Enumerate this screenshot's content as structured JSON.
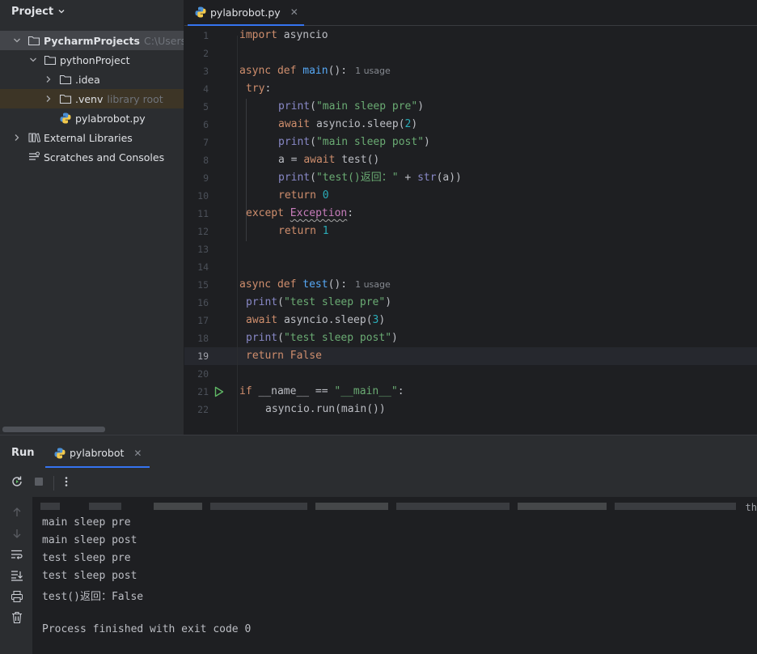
{
  "project_panel": {
    "title": "Project",
    "tree": [
      {
        "name": "PycharmProjects",
        "path": "C:\\Users\\m"
      },
      {
        "name": "pythonProject"
      },
      {
        "name": ".idea"
      },
      {
        "name": ".venv",
        "note": "library root"
      },
      {
        "name": "pylabrobot.py"
      },
      {
        "name": "External Libraries"
      },
      {
        "name": "Scratches and Consoles"
      }
    ]
  },
  "editor": {
    "tab_label": "pylabrobot.py",
    "current_line": 19,
    "line_numbers": [
      "1",
      "2",
      "3",
      "4",
      "5",
      "6",
      "7",
      "8",
      "9",
      "10",
      "11",
      "12",
      "13",
      "14",
      "15",
      "16",
      "17",
      "18",
      "19",
      "20",
      "21",
      "22"
    ],
    "code": {
      "l1_kw": "import",
      "l1_rest": " asyncio",
      "l3_kw1": "async",
      "l3_kw2": "def",
      "l3_fn": "main",
      "l3_rest": "():",
      "l3_hint": "1 usage",
      "l4_kw": "try",
      "l4_rest": ":",
      "l5_bi": "print",
      "l5_p1": "(",
      "l5_str": "\"main sleep pre\"",
      "l5_p2": ")",
      "l6_kw": "await",
      "l6_rest": " asyncio.sleep(",
      "l6_num": "2",
      "l6_p2": ")",
      "l7_bi": "print",
      "l7_p1": "(",
      "l7_str": "\"main sleep post\"",
      "l7_p2": ")",
      "l8_a": "a = ",
      "l8_kw": "await",
      "l8_rest": " test()",
      "l9_bi": "print",
      "l9_p1": "(",
      "l9_str": "\"test()返回：\"",
      "l9_mid": " + ",
      "l9_bi2": "str",
      "l9_p2": "(a))",
      "l10_kw": "return",
      "l10_num": "0",
      "l11_kw": "except",
      "l11_cls": "Exception",
      "l11_rest": ":",
      "l12_kw": "return",
      "l12_num": "1",
      "l15_kw1": "async",
      "l15_kw2": "def",
      "l15_fn": "test",
      "l15_rest": "():",
      "l15_hint": "1 usage",
      "l16_bi": "print",
      "l16_p1": "(",
      "l16_str": "\"test sleep pre\"",
      "l16_p2": ")",
      "l17_kw": "await",
      "l17_rest": " asyncio.sleep(",
      "l17_num": "3",
      "l17_p2": ")",
      "l18_bi": "print",
      "l18_p1": "(",
      "l18_str": "\"test sleep post\"",
      "l18_p2": ")",
      "l19_kw": "return",
      "l19_kw2": "False",
      "l21_kw": "if",
      "l21_mid": " __name__ == ",
      "l21_str": "\"__main__\"",
      "l21_rest": ":",
      "l22_rest": "asyncio.run(main())"
    }
  },
  "run_panel": {
    "title": "Run",
    "tab_label": "pylabrobot",
    "blurred_tail": "th",
    "output": [
      "main sleep pre",
      "main sleep post",
      "test sleep pre",
      "test sleep post",
      "test()返回：False",
      "",
      "Process finished with exit code 0"
    ]
  },
  "colors": {
    "keyword": "#cf8e6d",
    "function": "#56a8f5",
    "string": "#6aab73",
    "number": "#2aacb8",
    "builtin": "#8888c6",
    "accent": "#3574f0",
    "run_green": "#5fb865"
  },
  "icons": {
    "folder": "folder-icon",
    "python_file": "python-file-icon",
    "libraries": "external-libraries-icon",
    "scratches": "scratches-icon",
    "run": "run-gutter-icon",
    "rerun": "rerun-icon",
    "stop": "stop-icon",
    "more": "more-vertical-icon"
  }
}
